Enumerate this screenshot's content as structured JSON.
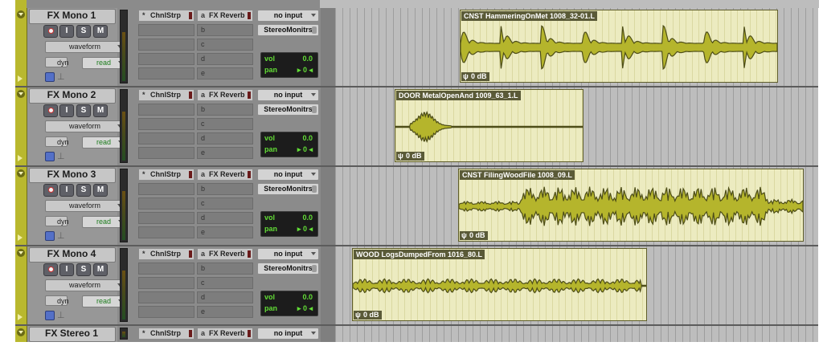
{
  "colors": {
    "clip_fill": "#ecebc0",
    "waveform": "#b5b52c",
    "track_strip": "#b9b82e",
    "vol_text": "#62dd36"
  },
  "tracks": [
    {
      "name": "FX Mono 1",
      "view": "waveform",
      "dyn": "dyn",
      "auto": "read",
      "inserts": [
        {
          "letter": "*",
          "label": "ChnlStrp"
        },
        {
          "letter": "",
          "label": ""
        },
        {
          "letter": "",
          "label": ""
        },
        {
          "letter": "",
          "label": ""
        },
        {
          "letter": "",
          "label": ""
        }
      ],
      "sends": [
        {
          "letter": "a",
          "label": "FX Reverb"
        },
        {
          "letter": "b",
          "label": ""
        },
        {
          "letter": "c",
          "label": ""
        },
        {
          "letter": "d",
          "label": ""
        },
        {
          "letter": "e",
          "label": ""
        }
      ],
      "input": "no input",
      "output": "StereoMonitrs",
      "vol_label": "vol",
      "vol": "0.0",
      "pan_label": "pan",
      "pan": "0",
      "clip": {
        "name": "CNST HammeringOnMet 1008_32-01.L",
        "gain": "0 dB"
      }
    },
    {
      "name": "FX Mono 2",
      "view": "waveform",
      "dyn": "dyn",
      "auto": "read",
      "inserts": [
        {
          "letter": "*",
          "label": "ChnlStrp"
        },
        {
          "letter": "",
          "label": ""
        },
        {
          "letter": "",
          "label": ""
        },
        {
          "letter": "",
          "label": ""
        },
        {
          "letter": "",
          "label": ""
        }
      ],
      "sends": [
        {
          "letter": "a",
          "label": "FX Reverb"
        },
        {
          "letter": "b",
          "label": ""
        },
        {
          "letter": "c",
          "label": ""
        },
        {
          "letter": "d",
          "label": ""
        },
        {
          "letter": "e",
          "label": ""
        }
      ],
      "input": "no input",
      "output": "StereoMonitrs",
      "vol_label": "vol",
      "vol": "0.0",
      "pan_label": "pan",
      "pan": "0",
      "clip": {
        "name": "DOOR MetalOpenAnd 1009_63_1.L",
        "gain": "0 dB"
      }
    },
    {
      "name": "FX Mono 3",
      "view": "waveform",
      "dyn": "dyn",
      "auto": "read",
      "inserts": [
        {
          "letter": "*",
          "label": "ChnlStrp"
        },
        {
          "letter": "",
          "label": ""
        },
        {
          "letter": "",
          "label": ""
        },
        {
          "letter": "",
          "label": ""
        },
        {
          "letter": "",
          "label": ""
        }
      ],
      "sends": [
        {
          "letter": "a",
          "label": "FX Reverb"
        },
        {
          "letter": "b",
          "label": ""
        },
        {
          "letter": "c",
          "label": ""
        },
        {
          "letter": "d",
          "label": ""
        },
        {
          "letter": "e",
          "label": ""
        }
      ],
      "input": "no input",
      "output": "StereoMonitrs",
      "vol_label": "vol",
      "vol": "0.0",
      "pan_label": "pan",
      "pan": "0",
      "clip": {
        "name": "CNST FilingWoodFile 1008_09.L",
        "gain": "0 dB"
      }
    },
    {
      "name": "FX Mono 4",
      "view": "waveform",
      "dyn": "dyn",
      "auto": "read",
      "inserts": [
        {
          "letter": "*",
          "label": "ChnlStrp"
        },
        {
          "letter": "",
          "label": ""
        },
        {
          "letter": "",
          "label": ""
        },
        {
          "letter": "",
          "label": ""
        },
        {
          "letter": "",
          "label": ""
        }
      ],
      "sends": [
        {
          "letter": "a",
          "label": "FX Reverb"
        },
        {
          "letter": "b",
          "label": ""
        },
        {
          "letter": "c",
          "label": ""
        },
        {
          "letter": "d",
          "label": ""
        },
        {
          "letter": "e",
          "label": ""
        }
      ],
      "input": "no input",
      "output": "StereoMonitrs",
      "vol_label": "vol",
      "vol": "0.0",
      "pan_label": "pan",
      "pan": "0",
      "clip": {
        "name": "WOOD LogsDumpedFrom 1016_80.L",
        "gain": "0 dB"
      }
    }
  ],
  "last_track": {
    "name": "FX Stereo 1",
    "insert": "ChnlStrp",
    "send_letter": "a",
    "send": "FX Reverb",
    "input": "no input"
  },
  "buttons": {
    "input": "I",
    "solo": "S",
    "mute": "M"
  },
  "send_letters": [
    "b",
    "c",
    "d",
    "e"
  ]
}
